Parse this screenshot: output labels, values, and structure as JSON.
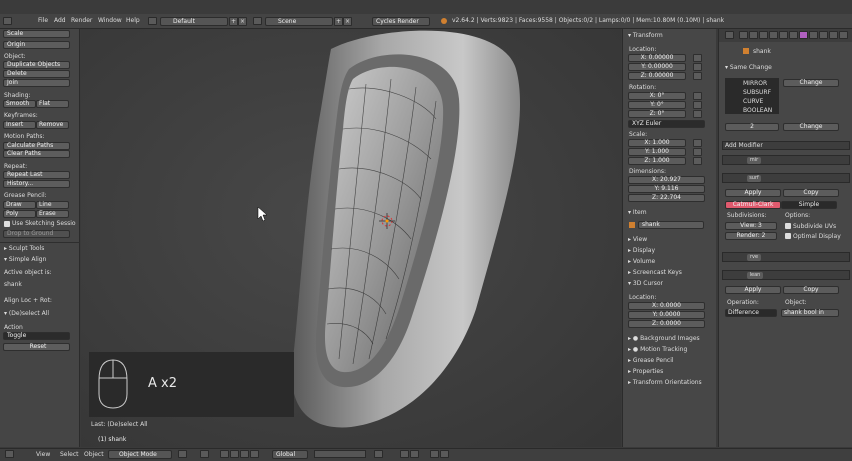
{
  "topbar": {
    "menus": [
      "File",
      "Add",
      "Render",
      "Window",
      "Help"
    ],
    "layout": "Default",
    "scene": "Scene",
    "engine": "Cycles Render",
    "stats": "v2.64.2 | Verts:9823 | Faces:9558 | Objects:0/2 | Lamps:0/0 | Mem:10.80M (0.10M) | shank"
  },
  "left": {
    "scale": "Scale",
    "origin": "Origin",
    "object_header": "Object:",
    "duplicate": "Duplicate Objects",
    "delete": "Delete",
    "join": "Join",
    "shading_header": "Shading:",
    "smooth": "Smooth",
    "flat": "Flat",
    "keyframes_header": "Keyframes:",
    "insert": "Insert",
    "remove": "Remove",
    "motion_header": "Motion Paths:",
    "calc_paths": "Calculate Paths",
    "clear_paths": "Clear Paths",
    "repeat_header": "Repeat:",
    "repeat_last": "Repeat Last",
    "history": "History...",
    "grease_header": "Grease Pencil:",
    "draw": "Draw",
    "line": "Line",
    "poly": "Poly",
    "erase": "Erase",
    "use_sketching": "Use Sketching Sessio",
    "drop_ground": "Drop to Ground",
    "sculpt_tools": "Sculpt Tools",
    "simple_align": "Simple Align",
    "active_object": "Active object is:",
    "shank": "shank",
    "align_loc": "Align Loc + Rot:",
    "deselect_all": "(De)select All",
    "action_label": "Action",
    "toggle": "Toggle",
    "reset": "Reset"
  },
  "viewport": {
    "keypress": "A x2",
    "last_op": "Last: (De)select All",
    "object_label": "(1) shank"
  },
  "npanel": {
    "transform": "Transform",
    "location": "Location:",
    "loc_x": "X: 0.00000",
    "loc_y": "Y: 0.00000",
    "loc_z": "Z: 0.00000",
    "rotation": "Rotation:",
    "rot_x": "X: 0°",
    "rot_y": "Y: 0°",
    "rot_z": "Z: 0°",
    "euler": "XYZ Euler",
    "scale": "Scale:",
    "sc_x": "X: 1.000",
    "sc_y": "Y: 1.000",
    "sc_z": "Z: 1.000",
    "dimensions": "Dimensions:",
    "dim_x": "X: 20.927",
    "dim_y": "Y: 9.116",
    "dim_z": "Z: 22.704",
    "item": "Item",
    "item_name": "shank",
    "view": "View",
    "display": "Display",
    "volume": "Volume",
    "screencast": "Screencast Keys",
    "cursor": "3D Cursor",
    "cursor_location": "Location:",
    "cur_x": "X: 0.0000",
    "cur_y": "Y: 0.0000",
    "cur_z": "Z: 0.0000",
    "bg_images": "Background Images",
    "motion_tracking": "Motion Tracking",
    "grease_pencil": "Grease Pencil",
    "properties": "Properties",
    "transform_orient": "Transform Orientations"
  },
  "props": {
    "object_name": "shank",
    "same_change": "Same Change",
    "mods": [
      "MIRROR",
      "SUBSURF",
      "CURVE",
      "BOOLEAN"
    ],
    "change": "Change",
    "level": "2",
    "change2": "Change",
    "add_modifier": "Add Modifier",
    "mod1": "mir",
    "mod2": "surf",
    "apply": "Apply",
    "copy": "Copy",
    "catmull": "Catmull-Clark",
    "simple": "Simple",
    "subdivisions": "Subdivisions:",
    "options": "Options:",
    "view_level": "View: 3",
    "render_level": "Render: 2",
    "subdivide_uvs": "Subdivide UVs",
    "optimal_display": "Optimal Display",
    "mod3": "rve",
    "mod4": "lean",
    "apply2": "Apply",
    "copy2": "Copy",
    "operation": "Operation:",
    "object": "Object:",
    "difference": "Difference",
    "bool_object": "shank bool in"
  },
  "bottombar": {
    "view": "View",
    "select": "Select",
    "object": "Object",
    "mode": "Object Mode",
    "orientation": "Global"
  }
}
